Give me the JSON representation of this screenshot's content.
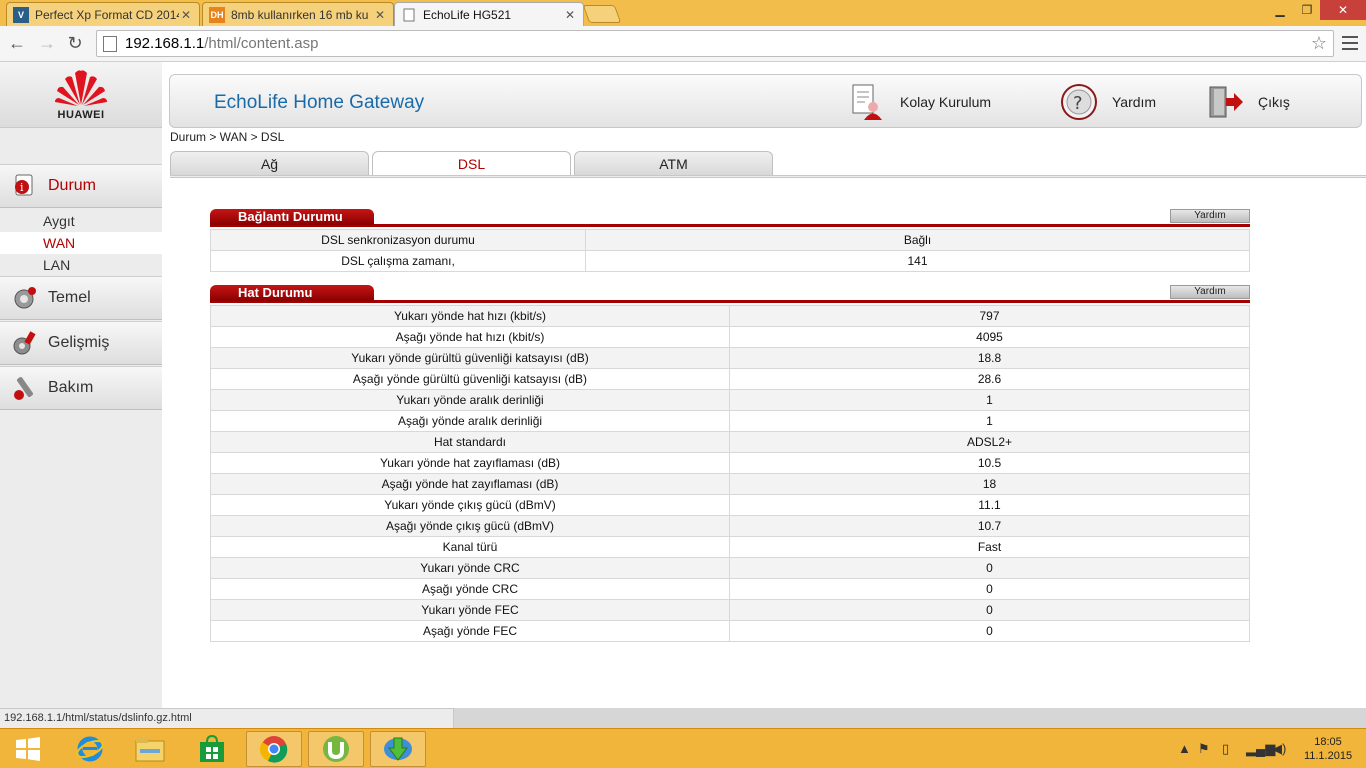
{
  "browser": {
    "tabs": [
      {
        "label": "Perfect Xp Format CD 2014",
        "favicon": "V",
        "active": false
      },
      {
        "label": "8mb kullanırken 16 mb ku",
        "favicon": "DH",
        "active": false
      },
      {
        "label": "EchoLife HG521",
        "favicon": "page",
        "active": true
      }
    ],
    "url_host": "192.168.1.1",
    "url_path": "/html/content.asp",
    "status_url": "192.168.1.1/html/status/dslinfo.gz.html"
  },
  "logo": {
    "text": "HUAWEI"
  },
  "header": {
    "title": "EchoLife Home Gateway",
    "quick_setup": "Kolay Kurulum",
    "help": "Yardım",
    "logout": "Çıkış"
  },
  "sidebar": {
    "sections": [
      {
        "label": "Durum",
        "active": true,
        "icon": "status-icon"
      },
      {
        "label": "Temel",
        "active": false,
        "icon": "basic-settings-icon"
      },
      {
        "label": "Gelişmiş",
        "active": false,
        "icon": "advanced-settings-icon"
      },
      {
        "label": "Bakım",
        "active": false,
        "icon": "maintenance-icon"
      }
    ],
    "sub_items": [
      {
        "label": "Aygıt",
        "active": false
      },
      {
        "label": "WAN",
        "active": true
      },
      {
        "label": "LAN",
        "active": false
      }
    ]
  },
  "breadcrumb": "Durum > WAN > DSL",
  "page_tabs": [
    {
      "label": "Ağ",
      "active": false
    },
    {
      "label": "DSL",
      "active": true
    },
    {
      "label": "ATM",
      "active": false
    }
  ],
  "connection": {
    "title": "Bağlantı Durumu",
    "help_label": "Yardım",
    "rows": [
      {
        "label": "DSL senkronizasyon durumu",
        "value": "Bağlı"
      },
      {
        "label": "DSL çalışma zamanı,",
        "value": "141"
      }
    ]
  },
  "line": {
    "title": "Hat Durumu",
    "help_label": "Yardım",
    "rows": [
      {
        "label": "Yukarı yönde hat hızı (kbit/s)",
        "value": "797"
      },
      {
        "label": "Aşağı yönde hat hızı (kbit/s)",
        "value": "4095"
      },
      {
        "label": "Yukarı yönde gürültü güvenliği katsayısı (dB)",
        "value": "18.8"
      },
      {
        "label": "Aşağı yönde gürültü güvenliği katsayısı (dB)",
        "value": "28.6"
      },
      {
        "label": "Yukarı yönde aralık derinliği",
        "value": "1"
      },
      {
        "label": "Aşağı yönde aralık derinliği",
        "value": "1"
      },
      {
        "label": "Hat standardı",
        "value": "ADSL2+"
      },
      {
        "label": "Yukarı yönde hat zayıflaması (dB)",
        "value": "10.5"
      },
      {
        "label": "Aşağı yönde hat zayıflaması (dB)",
        "value": "18"
      },
      {
        "label": "Yukarı yönde çıkış gücü (dBmV)",
        "value": "11.1"
      },
      {
        "label": "Aşağı yönde çıkış gücü (dBmV)",
        "value": "10.7"
      },
      {
        "label": "Kanal türü",
        "value": "Fast"
      },
      {
        "label": "Yukarı yönde CRC",
        "value": "0"
      },
      {
        "label": "Aşağı yönde CRC",
        "value": "0"
      },
      {
        "label": "Yukarı yönde FEC",
        "value": "0"
      },
      {
        "label": "Aşağı yönde FEC",
        "value": "0"
      }
    ]
  },
  "taskbar": {
    "apps": [
      "internet-explorer-icon",
      "file-explorer-icon",
      "store-icon",
      "chrome-icon",
      "utorrent-icon",
      "internet-download-manager-icon"
    ],
    "time": "18:05",
    "date": "11.1.2015"
  },
  "colors": {
    "accent": "#b30000",
    "header_title": "#1a6aa8",
    "taskbar": "#f0b53a"
  }
}
